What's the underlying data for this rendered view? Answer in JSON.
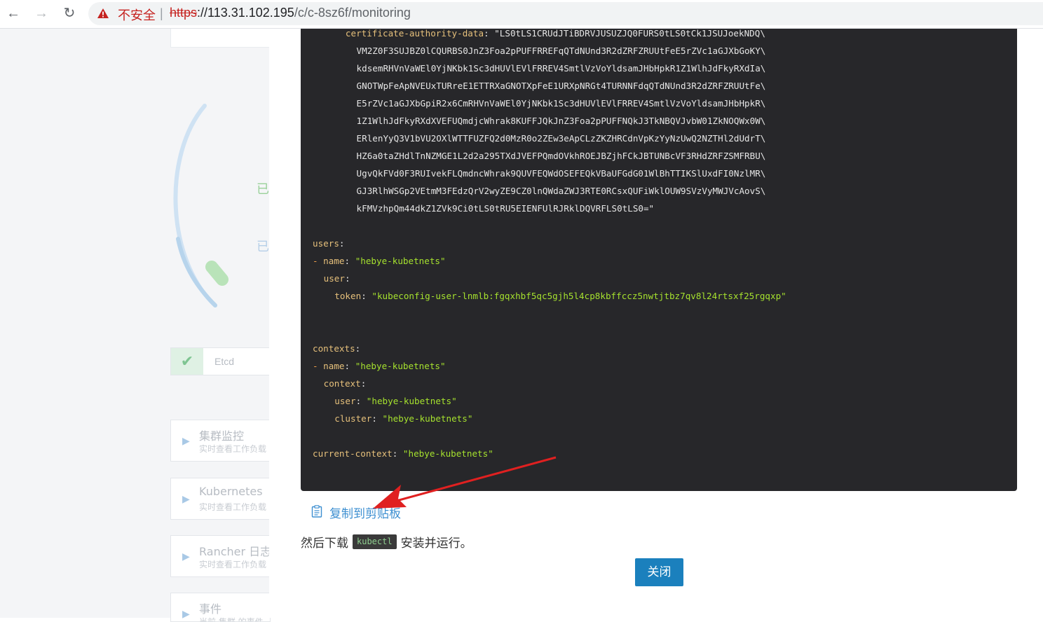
{
  "browser": {
    "security_label": "不安全",
    "separator": "|",
    "url_scheme": "https",
    "url_host": "://113.31.102.195",
    "url_path": "/c/c-8sz6f/monitoring",
    "back_glyph": "←",
    "forward_glyph": "→",
    "reload_glyph": "↻"
  },
  "background": {
    "gauge_chars": [
      "已",
      "已"
    ],
    "etcd_label": "Etcd",
    "cards": [
      {
        "title": "集群监控",
        "subtitle": "实时查看工作负载"
      },
      {
        "title": "Kubernetes",
        "subtitle": "实时查看工作负载"
      },
      {
        "title": "Rancher 日志",
        "subtitle": "实时查看工作负载"
      },
      {
        "title": "事件",
        "subtitle": "当前 集群 的事件"
      }
    ]
  },
  "kubeconfig": {
    "lines": [
      {
        "indent": 6,
        "key": "certificate-authority-data",
        "value": "\"LS0tLS1CRUdJTiBDRVJUSUZJQ0FURS0tLS0tCk1JSUJoekNDQ\\",
        "vtype": "p"
      },
      {
        "indent": 8,
        "key": "",
        "value": "VM2Z0F3SUJBZ0lCQURBS0JnZ3Foa2pPUFFRREFqQTdNUnd3R2dZRFZRUUtFeE5rZVc1aGJXbGoKY\\",
        "vtype": "p"
      },
      {
        "indent": 8,
        "key": "",
        "value": "kdsemRHVnVaWEl0YjNKbk1Sc3dHUVlEVlFRREV4SmtlVzVoYldsamJHbHpkR1Z1WlhJdFkyRXdIa\\",
        "vtype": "p"
      },
      {
        "indent": 8,
        "key": "",
        "value": "GNOTWpFeApNVEUxTURreE1ETTRXaGNOTXpFeE1URXpNRGt4TURNNFdqQTdNUnd3R2dZRFZRUUtFe\\",
        "vtype": "p"
      },
      {
        "indent": 8,
        "key": "",
        "value": "E5rZVc1aGJXbGpiR2x6CmRHVnVaWEl0YjNKbk1Sc3dHUVlEVlFRREV4SmtlVzVoYldsamJHbHpkR\\",
        "vtype": "p"
      },
      {
        "indent": 8,
        "key": "",
        "value": "1Z1WlhJdFkyRXdXVEFUQmdjcWhrak8KUFFJQkJnZ3Foa2pPUFFNQkJ3TkNBQVJvbW01ZkNOQWx0W\\",
        "vtype": "p"
      },
      {
        "indent": 8,
        "key": "",
        "value": "ERlenYyQ3V1bVU2OXlWTTFUZFQ2d0MzR0o2ZEw3eApCLzZKZHRCdnVpKzYyNzUwQ2NZTHl2dUdrT\\",
        "vtype": "p"
      },
      {
        "indent": 8,
        "key": "",
        "value": "HZ6a0taZHdlTnNZMGE1L2d2a295TXdJVEFPQmdOVkhROEJBZjhFCkJBTUNBcVF3RHdZRFZSMFRBU\\",
        "vtype": "p"
      },
      {
        "indent": 8,
        "key": "",
        "value": "UgvQkFVd0F3RUIvekFLQmdncWhrak9QUVFEQWdOSEFEQkVBaUFGdG01WlBhTTIKSlUxdFI0NzlMR\\",
        "vtype": "p"
      },
      {
        "indent": 8,
        "key": "",
        "value": "GJ3RlhWSGp2VEtmM3FEdzQrV2wyZE9CZ0lnQWdaZWJ3RTE0RCsxQUFiWklOUW9SVzVyMWJVcAovS\\",
        "vtype": "p"
      },
      {
        "indent": 8,
        "key": "",
        "value": "kFMVzhpQm44dkZ1ZVk9Ci0tLS0tRU5EIENFUlRJRklDQVRFLS0tLS0=\"",
        "vtype": "p"
      },
      {
        "indent": 0,
        "key": "",
        "value": "",
        "vtype": "p"
      },
      {
        "indent": 0,
        "key": "users",
        "value": "",
        "vtype": "p"
      },
      {
        "indent": 0,
        "key": "name",
        "dash": true,
        "value": "\"hebye-kubetnets\"",
        "vtype": "s"
      },
      {
        "indent": 2,
        "key": "user",
        "value": "",
        "vtype": "p"
      },
      {
        "indent": 4,
        "key": "token",
        "value": "\"kubeconfig-user-lnmlb:fgqxhbf5qc5gjh5l4cp8kbffccz5nwtjtbz7qv8l24rtsxf25rgqxp\"",
        "vtype": "s"
      },
      {
        "indent": 0,
        "key": "",
        "value": "",
        "vtype": "p"
      },
      {
        "indent": 0,
        "key": "",
        "value": "",
        "vtype": "p"
      },
      {
        "indent": 0,
        "key": "contexts",
        "value": "",
        "vtype": "p"
      },
      {
        "indent": 0,
        "key": "name",
        "dash": true,
        "value": "\"hebye-kubetnets\"",
        "vtype": "s"
      },
      {
        "indent": 2,
        "key": "context",
        "value": "",
        "vtype": "p"
      },
      {
        "indent": 4,
        "key": "user",
        "value": "\"hebye-kubetnets\"",
        "vtype": "s"
      },
      {
        "indent": 4,
        "key": "cluster",
        "value": "\"hebye-kubetnets\"",
        "vtype": "s"
      },
      {
        "indent": 0,
        "key": "",
        "value": "",
        "vtype": "p"
      },
      {
        "indent": 0,
        "key": "current-context",
        "value": "\"hebye-kubetnets\"",
        "vtype": "s"
      }
    ]
  },
  "modal": {
    "copy_label": "复制到剪贴板",
    "download_prefix": "然后下载",
    "download_code": "kubectl",
    "download_suffix": "安装并运行。",
    "close_label": "关闭"
  },
  "colors": {
    "code_bg": "#27272a",
    "yaml_key": "#e6c07b",
    "yaml_string": "#a6e22e",
    "link_blue": "#3d8fd1",
    "button_blue": "#1b80bd",
    "annotation_red": "#e02020"
  }
}
